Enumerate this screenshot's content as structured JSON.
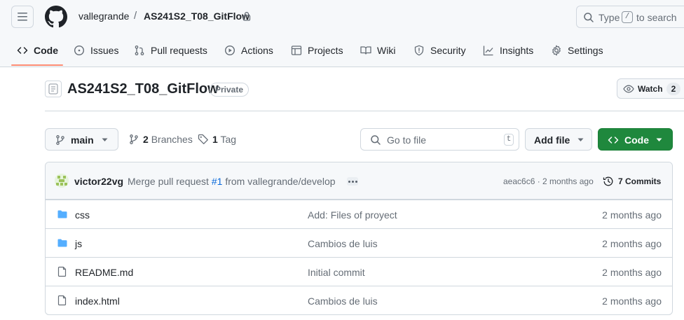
{
  "header": {
    "owner": "vallegrande",
    "separator": "/",
    "repo": "AS241S2_T08_GitFlow",
    "search": {
      "before": "Type",
      "key": "/",
      "after": "to search"
    }
  },
  "nav": {
    "items": [
      {
        "label": "Code",
        "icon": "code-icon",
        "active": true
      },
      {
        "label": "Issues",
        "icon": "issue-icon"
      },
      {
        "label": "Pull requests",
        "icon": "pull-request-icon"
      },
      {
        "label": "Actions",
        "icon": "play-icon"
      },
      {
        "label": "Projects",
        "icon": "table-icon"
      },
      {
        "label": "Wiki",
        "icon": "book-icon"
      },
      {
        "label": "Security",
        "icon": "shield-icon"
      },
      {
        "label": "Insights",
        "icon": "graph-icon"
      },
      {
        "label": "Settings",
        "icon": "gear-icon"
      }
    ],
    "active_color": "#fd8c73"
  },
  "repo": {
    "title": "AS241S2_T08_GitFlow",
    "visibility": "Private",
    "watch_label": "Watch",
    "watch_count": "2"
  },
  "toolbar": {
    "branch": "main",
    "branches_count": "2",
    "branches_label": "Branches",
    "tags_count": "1",
    "tags_label": "Tag",
    "goto_placeholder": "Go to file",
    "goto_key": "t",
    "add_file": "Add file",
    "code": "Code",
    "code_color": "#1f883d"
  },
  "latest_commit": {
    "user": "victor22vg",
    "message_before": "Merge pull request",
    "pr": "#1",
    "message_after": "from vallegrande/develop",
    "hash_age": "aeac6c6 · 2 months ago",
    "commits": "7 Commits"
  },
  "files": [
    {
      "type": "folder",
      "name": "css",
      "message": "Add: Files of proyect",
      "age": "2 months ago"
    },
    {
      "type": "folder",
      "name": "js",
      "message": "Cambios de luis",
      "age": "2 months ago"
    },
    {
      "type": "file",
      "name": "README.md",
      "message": "Initial commit",
      "age": "2 months ago"
    },
    {
      "type": "file",
      "name": "index.html",
      "message": "Cambios de luis",
      "age": "2 months ago"
    }
  ]
}
